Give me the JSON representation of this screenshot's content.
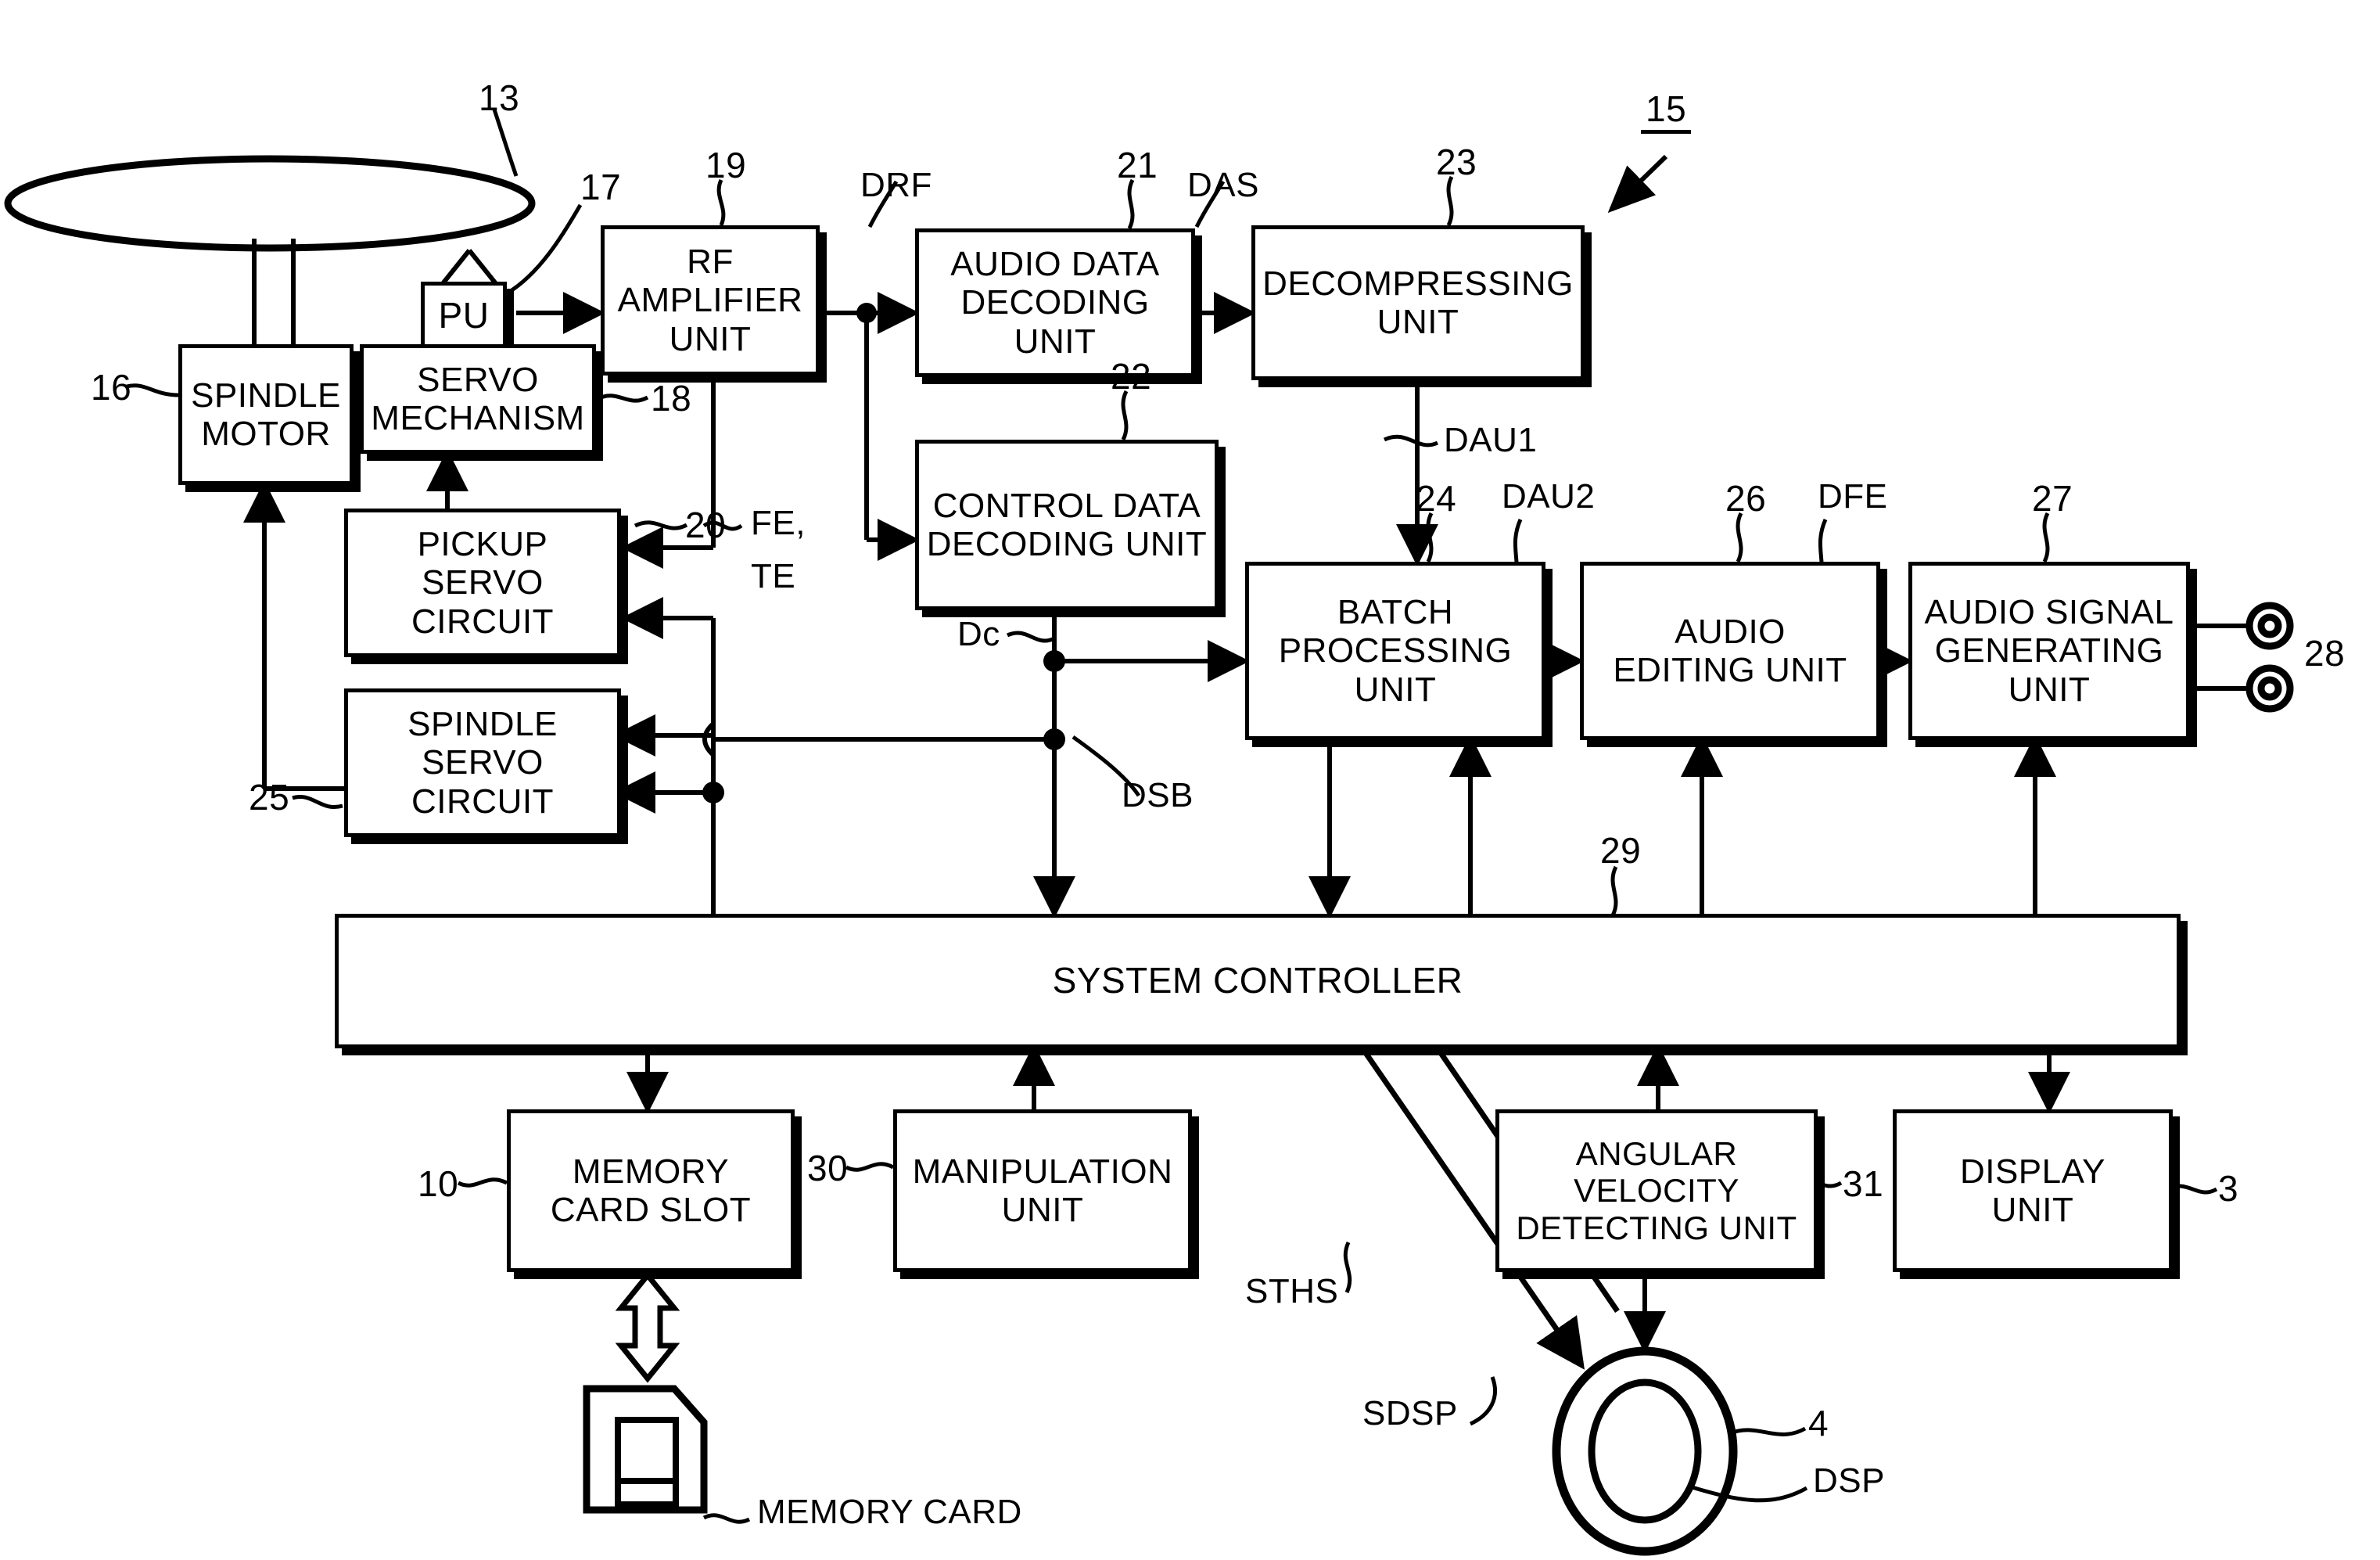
{
  "figure": {
    "assembly_ref": "15",
    "type": "block-diagram"
  },
  "blocks": {
    "pu": {
      "lines": [
        "PU"
      ],
      "ref": "17"
    },
    "spindle_motor": {
      "lines": [
        "SPINDLE",
        "MOTOR"
      ],
      "ref": "16"
    },
    "servo_mechanism": {
      "lines": [
        "SERVO",
        "MECHANISM"
      ],
      "ref": "18"
    },
    "rf_amplifier": {
      "lines": [
        "RF",
        "AMPLIFIER",
        "UNIT"
      ],
      "ref": "19"
    },
    "audio_data_decoding": {
      "lines": [
        "AUDIO DATA",
        "DECODING",
        "UNIT"
      ],
      "ref": "21"
    },
    "decompressing": {
      "lines": [
        "DECOMPRESSING",
        "UNIT"
      ],
      "ref": "23"
    },
    "control_data_decoding": {
      "lines": [
        "CONTROL DATA",
        "DECODING UNIT"
      ],
      "ref": "22"
    },
    "pickup_servo": {
      "lines": [
        "PICKUP",
        "SERVO",
        "CIRCUIT"
      ],
      "ref": "20"
    },
    "spindle_servo": {
      "lines": [
        "SPINDLE",
        "SERVO",
        "CIRCUIT"
      ],
      "ref": "25"
    },
    "batch_processing": {
      "lines": [
        "BATCH",
        "PROCESSING",
        "UNIT"
      ],
      "ref": "24"
    },
    "audio_editing": {
      "lines": [
        "AUDIO",
        "EDITING UNIT"
      ],
      "ref": "26"
    },
    "audio_signal_generating": {
      "lines": [
        "AUDIO SIGNAL",
        "GENERATING",
        "UNIT"
      ],
      "ref": "27"
    },
    "system_controller": {
      "lines": [
        "SYSTEM CONTROLLER"
      ],
      "ref": "29"
    },
    "memory_card_slot": {
      "lines": [
        "MEMORY",
        "CARD SLOT"
      ],
      "ref": "10"
    },
    "manipulation": {
      "lines": [
        "MANIPULATION",
        "UNIT"
      ],
      "ref": "30"
    },
    "angular_velocity_detecting": {
      "lines": [
        "ANGULAR",
        "VELOCITY",
        "DETECTING UNIT"
      ],
      "ref": "31"
    },
    "display": {
      "lines": [
        "DISPLAY",
        "UNIT"
      ],
      "ref": "3"
    }
  },
  "signals": {
    "drf": "DRF",
    "das": "DAS",
    "dau1": "DAU1",
    "dau2": "DAU2",
    "dfe": "DFE",
    "dc": "Dc",
    "dsb": "DSB",
    "fe_te_line1": "FE,",
    "fe_te_line2": "TE",
    "sths": "STHS",
    "sdsp": "SDSP"
  },
  "parts": {
    "disc_ref": "13",
    "output_jacks_ref": "28",
    "memory_card_label": "MEMORY CARD",
    "dsp_label": "DSP",
    "dsp_ref": "4"
  },
  "refs": {
    "r3": "3",
    "r4": "4",
    "r10": "10",
    "r13": "13",
    "r15": "15",
    "r16": "16",
    "r17": "17",
    "r18": "18",
    "r19": "19",
    "r20": "20",
    "r21": "21",
    "r22": "22",
    "r23": "23",
    "r24": "24",
    "r25": "25",
    "r26": "26",
    "r27": "27",
    "r28": "28",
    "r29": "29",
    "r30": "30",
    "r31": "31"
  },
  "colors": {
    "ink": "#000000",
    "paper": "#ffffff"
  }
}
